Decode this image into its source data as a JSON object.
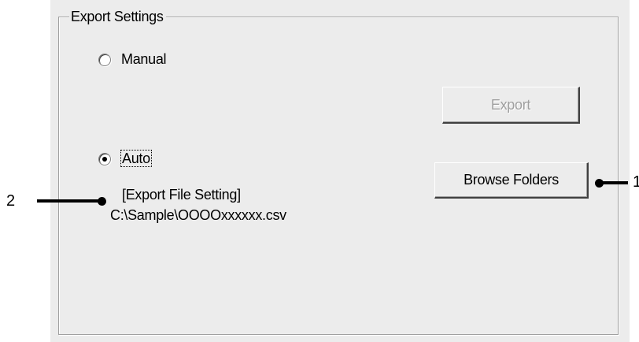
{
  "group": {
    "title": "Export Settings"
  },
  "options": {
    "manual": {
      "label": "Manual",
      "selected": false
    },
    "auto": {
      "label": "Auto",
      "selected": true
    }
  },
  "export_file": {
    "heading": "[Export File Setting]",
    "path": "C:\\Sample\\OOOOxxxxxx.csv"
  },
  "buttons": {
    "export": {
      "label": "Export",
      "enabled": false
    },
    "browse": {
      "label": "Browse Folders",
      "enabled": true
    }
  },
  "callouts": {
    "one": "1",
    "two": "2"
  }
}
